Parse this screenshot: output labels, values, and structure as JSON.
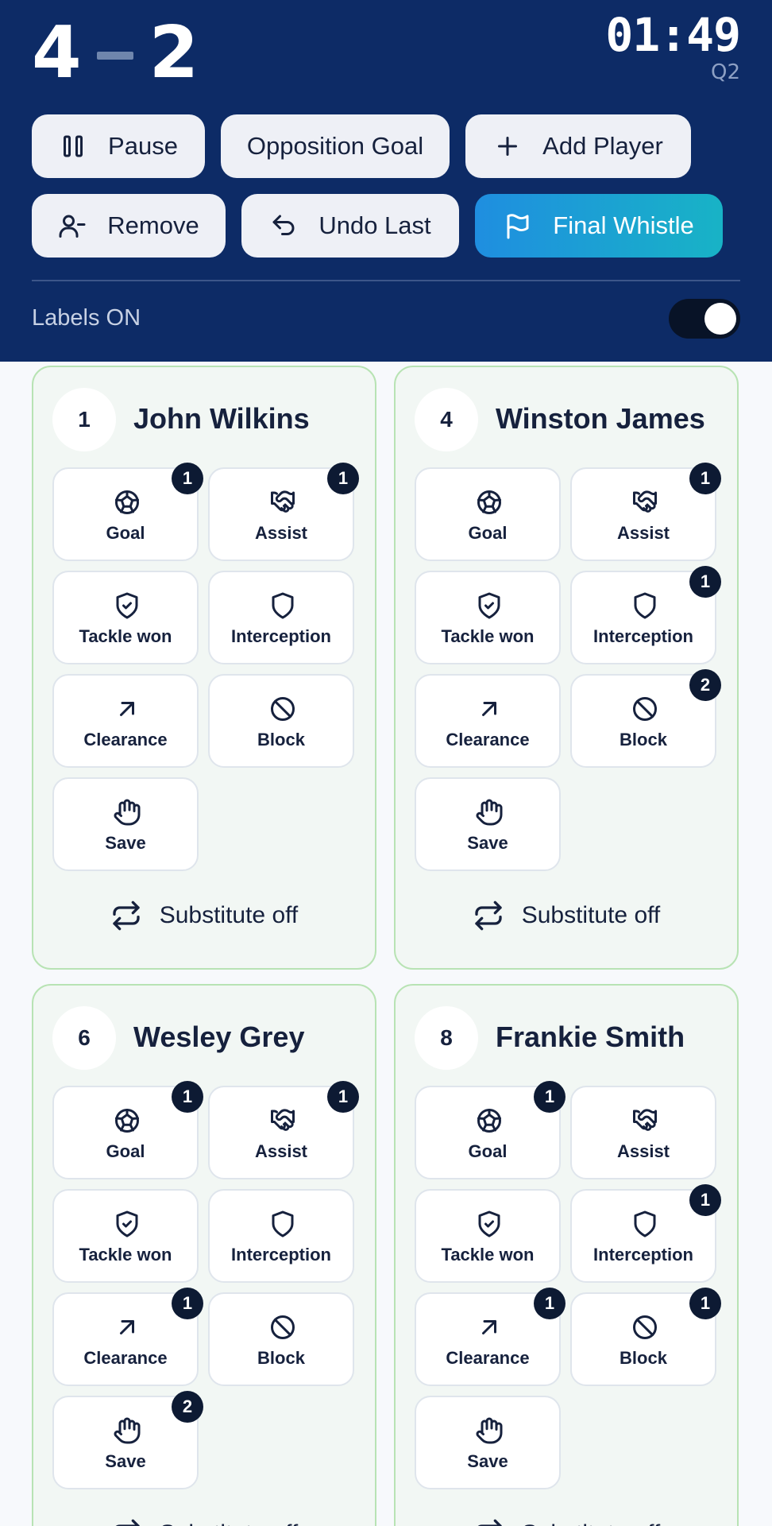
{
  "score": {
    "home": "4",
    "away": "2"
  },
  "clock": {
    "time": "01:49",
    "period": "Q2"
  },
  "actions": {
    "pause": "Pause",
    "opposition_goal": "Opposition Goal",
    "add_player": "Add Player",
    "remove": "Remove",
    "undo_last": "Undo Last",
    "final_whistle": "Final Whistle"
  },
  "labels_toggle": {
    "label": "Labels ON",
    "on": true
  },
  "stat_labels": {
    "goal": "Goal",
    "assist": "Assist",
    "tackle": "Tackle won",
    "interception": "Interception",
    "clearance": "Clearance",
    "block": "Block",
    "save": "Save"
  },
  "substitute_label": "Substitute off",
  "icons": [
    "pause-icon",
    "plus-icon",
    "remove-user-icon",
    "undo-icon",
    "flag-icon",
    "football-icon",
    "handshake-icon",
    "shield-check-icon",
    "shield-icon",
    "arrow-up-right-icon",
    "block-icon",
    "hand-icon",
    "swap-icon"
  ],
  "colors": {
    "header_bg": "#0d2b66",
    "card_border": "#b8e3b4",
    "badge_bg": "#0d1a33",
    "final_whistle_from": "#1f8ee0",
    "final_whistle_to": "#18b3c6"
  },
  "players": [
    {
      "number": "1",
      "name": "John Wilkins",
      "counts": {
        "goal": "1",
        "assist": "1",
        "tackle": "",
        "interception": "",
        "clearance": "",
        "block": "",
        "save": ""
      }
    },
    {
      "number": "4",
      "name": "Winston James",
      "counts": {
        "goal": "",
        "assist": "1",
        "tackle": "",
        "interception": "1",
        "clearance": "",
        "block": "2",
        "save": ""
      }
    },
    {
      "number": "6",
      "name": "Wesley Grey",
      "counts": {
        "goal": "1",
        "assist": "1",
        "tackle": "",
        "interception": "",
        "clearance": "1",
        "block": "",
        "save": "2"
      }
    },
    {
      "number": "8",
      "name": "Frankie Smith",
      "counts": {
        "goal": "1",
        "assist": "",
        "tackle": "",
        "interception": "1",
        "clearance": "1",
        "block": "1",
        "save": ""
      }
    }
  ]
}
